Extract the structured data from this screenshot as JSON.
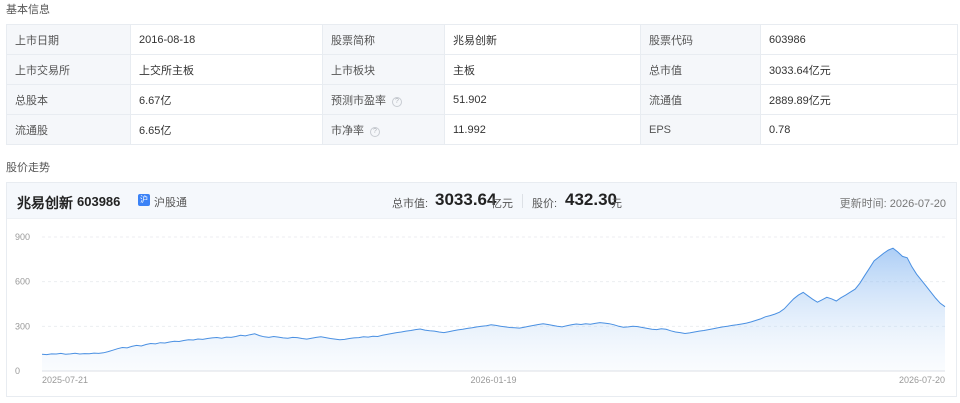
{
  "basic": {
    "title": "基本信息",
    "rows": [
      [
        {
          "k": "上市日期",
          "v": "2016-08-18"
        },
        {
          "k": "股票简称",
          "v": "兆易创新"
        },
        {
          "k": "股票代码",
          "v": "603986"
        }
      ],
      [
        {
          "k": "上市交易所",
          "v": "上交所主板"
        },
        {
          "k": "上市板块",
          "v": "主板"
        },
        {
          "k": "总市值",
          "v": "3033.64亿元"
        }
      ],
      [
        {
          "k": "总股本",
          "v": "6.67亿"
        },
        {
          "k": "预测市盈率",
          "v": "51.902",
          "help": true
        },
        {
          "k": "流通值",
          "v": "2889.89亿元"
        }
      ],
      [
        {
          "k": "流通股",
          "v": "6.65亿"
        },
        {
          "k": "市净率",
          "v": "11.992",
          "help": true
        },
        {
          "k": "EPS",
          "v": "0.78"
        }
      ]
    ],
    "help_icon": "question-circle-icon"
  },
  "trend": {
    "title": "股价走势",
    "stock_name": "兆易创新",
    "stock_code": "603986",
    "badge_char": "沪",
    "badge_label": "沪股通",
    "mcap_label": "总市值:",
    "mcap_value": "3033.64",
    "mcap_unit": "亿元",
    "price_label": "股价:",
    "price_value": "432.30",
    "price_unit": "元",
    "update_time": "更新时间: 2026-07-20",
    "accent": "#4a90e2"
  },
  "chart_data": {
    "type": "area",
    "ylim": [
      0,
      900
    ],
    "yticks": [
      0,
      300,
      600,
      900
    ],
    "xticks": [
      "2025-07-21",
      "2026-01-19",
      "2026-07-20"
    ],
    "grid": true,
    "x_start": "2025-07-21",
    "x_end": "2026-07-20",
    "values": [
      112,
      110,
      115,
      114,
      118,
      113,
      115,
      119,
      114,
      117,
      116,
      120,
      118,
      122,
      130,
      140,
      150,
      158,
      155,
      165,
      172,
      168,
      178,
      185,
      182,
      190,
      188,
      195,
      200,
      198,
      205,
      210,
      208,
      215,
      212,
      218,
      222,
      225,
      220,
      228,
      226,
      232,
      240,
      236,
      244,
      250,
      238,
      230,
      226,
      232,
      228,
      222,
      220,
      226,
      224,
      218,
      214,
      220,
      226,
      230,
      224,
      218,
      214,
      210,
      212,
      218,
      222,
      224,
      230,
      228,
      234,
      232,
      240,
      246,
      252,
      258,
      262,
      268,
      272,
      278,
      282,
      275,
      270,
      268,
      262,
      258,
      264,
      270,
      276,
      280,
      286,
      290,
      296,
      300,
      304,
      310,
      306,
      300,
      296,
      292,
      290,
      288,
      294,
      300,
      306,
      312,
      318,
      312,
      306,
      300,
      296,
      304,
      310,
      316,
      312,
      318,
      314,
      320,
      325,
      322,
      318,
      310,
      300,
      294,
      296,
      300,
      298,
      292,
      286,
      280,
      278,
      284,
      280,
      270,
      262,
      258,
      252,
      256,
      262,
      268,
      272,
      278,
      284,
      290,
      296,
      300,
      306,
      310,
      316,
      322,
      330,
      340,
      350,
      364,
      372,
      382,
      395,
      418,
      452,
      485,
      510,
      528,
      505,
      482,
      462,
      478,
      495,
      485,
      470,
      492,
      510,
      530,
      550,
      590,
      640,
      690,
      740,
      765,
      790,
      812,
      825,
      800,
      770,
      760,
      700,
      650,
      610,
      570,
      530,
      490,
      455,
      432
    ]
  }
}
